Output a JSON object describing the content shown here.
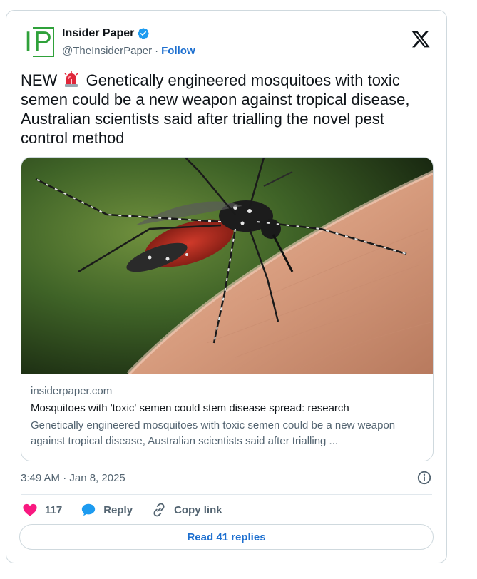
{
  "author": {
    "avatar_text": "IP",
    "name": "Insider Paper",
    "handle": "@TheInsiderPaper",
    "separator": "·",
    "follow_label": "Follow"
  },
  "tweet": {
    "text_prefix": "NEW",
    "text_body": "Genetically engineered mosquitoes with toxic semen could be a new weapon against tropical disease, Australian scientists said after trialling the novel pest control method"
  },
  "link_card": {
    "domain": "insiderpaper.com",
    "title": "Mosquitoes with 'toxic' semen could stem disease spread: research",
    "description": "Genetically engineered mosquitoes with toxic semen could be a new weapon against tropical disease, Australian scientists said after trialling ..."
  },
  "timestamp": "3:49 AM · Jan 8, 2025",
  "actions": {
    "like_count": "117",
    "reply_label": "Reply",
    "copy_link_label": "Copy link"
  },
  "read_replies_label": "Read 41 replies",
  "icons": {
    "verified": "verified-badge-icon",
    "x_logo": "x-logo-icon",
    "siren": "siren-emoji-icon",
    "info": "info-icon",
    "heart": "heart-icon",
    "reply": "reply-bubble-icon",
    "link": "link-icon"
  },
  "colors": {
    "accent": "#1d6fcf",
    "verified": "#1d9bf0",
    "heart": "#f91880",
    "reply": "#1d9bf0",
    "avatar_green": "#2fa13a"
  }
}
